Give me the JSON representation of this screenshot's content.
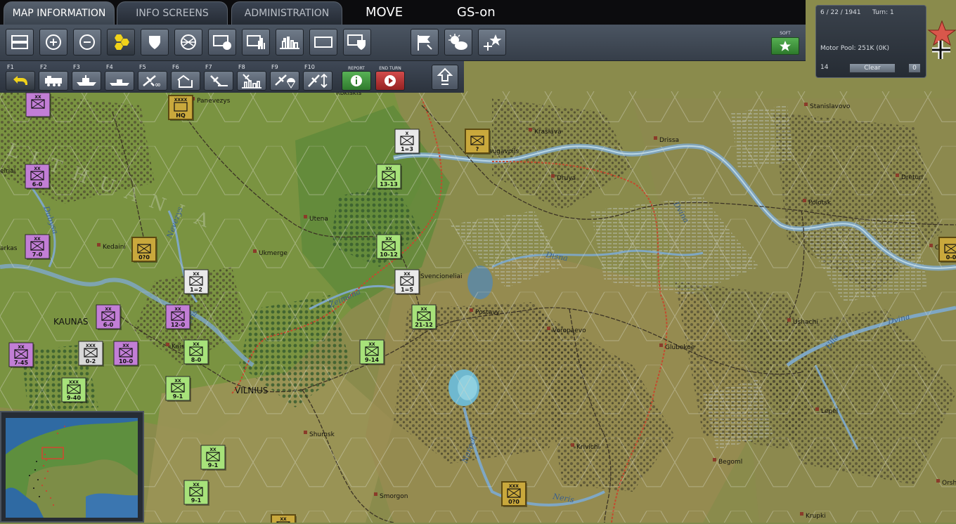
{
  "tabs": [
    "MAP INFORMATION",
    "INFO SCREENS",
    "ADMINISTRATION"
  ],
  "modes": [
    "MOVE",
    "GS-on"
  ],
  "toolbar_icons": [
    "zoom-window-icon",
    "zoom-in-icon",
    "zoom-out-icon",
    "hex-grid-icon",
    "shield-icon",
    "network-icon",
    "unit-counter-icon",
    "bar-counter-icon",
    "terrain-icon",
    "rectangle-icon",
    "unit-shield-icon",
    "flag-icon",
    "weather-icon",
    "airbase-icon"
  ],
  "soft": {
    "label": "SOFT"
  },
  "fkeys": [
    {
      "label": "F1",
      "icon": "return-icon"
    },
    {
      "label": "F2",
      "icon": "train-icon"
    },
    {
      "label": "F3",
      "icon": "ship-icon"
    },
    {
      "label": "F4",
      "icon": "submarine-icon"
    },
    {
      "label": "F5",
      "icon": "air-transport-icon"
    },
    {
      "label": "F6",
      "icon": "air-range-icon"
    },
    {
      "label": "F7",
      "icon": "air-bomb-icon"
    },
    {
      "label": "F8",
      "icon": "air-city-icon"
    },
    {
      "label": "F9",
      "icon": "paradrop-icon"
    },
    {
      "label": "F10",
      "icon": "air-move-icon"
    }
  ],
  "report": {
    "label": "REPORT"
  },
  "end_turn": {
    "label": "END TURN"
  },
  "panel": {
    "date": "6 / 22 / 1941",
    "turn": "Turn: 1",
    "motor_pool": "Motor Pool:  251K (0K)",
    "count": "14",
    "clear": "Clear",
    "zero": "0"
  },
  "map": {
    "region_label": "LITHUANIA",
    "big_cities": [
      "KAUNAS",
      "VILNIUS"
    ],
    "towns": [
      "Rokiskis",
      "Panevezys",
      "Stanislavovo",
      "Kraslava",
      "Drissa",
      "Daugavpils",
      "Druya",
      "Dretun",
      "Utena",
      "Polotsk",
      "Kedaini",
      "Ukmerge",
      "Gorodo",
      "Svencioneliai",
      "Postavy",
      "Ushachi",
      "Voropaevo",
      "Glubokoe",
      "Kaisiadorys",
      "Lepel",
      "Shumsk",
      "Krivichi",
      "Begoml",
      "Smorgon",
      "Orsh",
      "Krupki",
      "eiriai",
      "arkas"
    ],
    "rivers": [
      "Dubysa",
      "Nevezys",
      "Neris",
      "Zeimena",
      "Disna",
      "Dvina",
      "Dvina",
      "Ulla",
      "Naroch",
      "Neris"
    ],
    "units": [
      {
        "size": "XX",
        "strength": "",
        "color": "#c27ed6"
      },
      {
        "size": "XX",
        "strength": "6-0",
        "color": "#c27ed6"
      },
      {
        "size": "XX",
        "strength": "7-0",
        "color": "#c27ed6"
      },
      {
        "size": "XX",
        "strength": "6-0",
        "color": "#c27ed6"
      },
      {
        "size": "XX",
        "strength": "12-0",
        "color": "#c27ed6"
      },
      {
        "size": "XX",
        "strength": "7-45",
        "color": "#c27ed6"
      },
      {
        "size": "XXX",
        "strength": "0-2",
        "color": "#d8d8d8"
      },
      {
        "size": "XX",
        "strength": "10-0",
        "color": "#c27ed6"
      },
      {
        "size": "XX",
        "strength": "8-0",
        "color": "#a7e27a"
      },
      {
        "size": "XXX",
        "strength": "9-40",
        "color": "#a7e27a"
      },
      {
        "size": "XX",
        "strength": "9-1",
        "color": "#a7e27a"
      },
      {
        "size": "XX",
        "strength": "9-1",
        "color": "#a7e27a"
      },
      {
        "size": "XX",
        "strength": "9-1",
        "color": "#a7e27a"
      },
      {
        "size": "XX",
        "strength": "9-14",
        "color": "#a7e27a"
      },
      {
        "size": "XX",
        "strength": "13-13",
        "color": "#a7e27a"
      },
      {
        "size": "XX",
        "strength": "10-12",
        "color": "#a7e27a"
      },
      {
        "size": "XX",
        "strength": "21-12",
        "color": "#a7e27a"
      },
      {
        "size": "X",
        "strength": "1=3",
        "color": "#e9e9e9"
      },
      {
        "size": "XX",
        "strength": "1=5",
        "color": "#e9e9e9"
      },
      {
        "size": "XX",
        "strength": "1=2",
        "color": "#e9e9e9"
      },
      {
        "size": "",
        "strength": "?",
        "color": "#c9a83c"
      },
      {
        "size": "XXXX",
        "strength": "HQ",
        "color": "#c9a83c"
      },
      {
        "size": "",
        "strength": "0?0",
        "color": "#c9a83c"
      },
      {
        "size": "XXX",
        "strength": "0?0",
        "color": "#c9a83c"
      },
      {
        "size": "",
        "strength": "0-0",
        "color": "#c9a83c"
      },
      {
        "size": "XX",
        "strength": "",
        "color": "#c9a83c"
      }
    ]
  }
}
